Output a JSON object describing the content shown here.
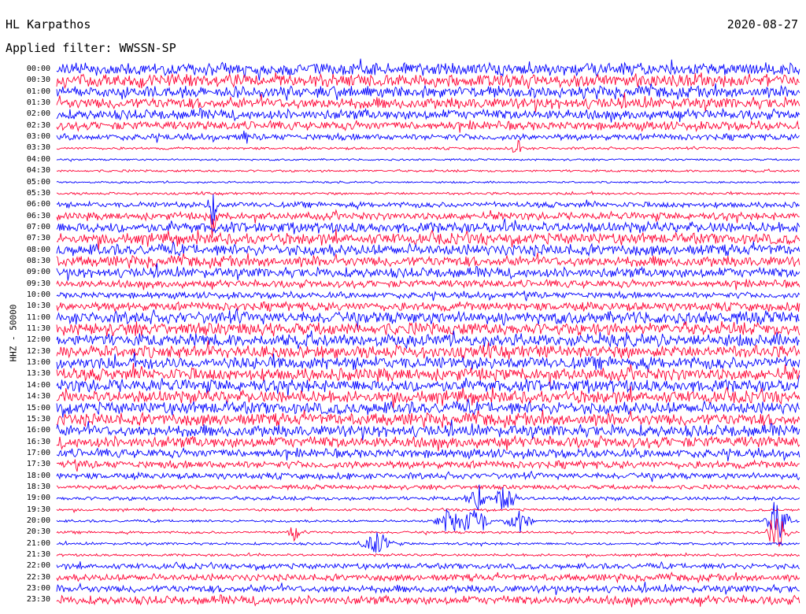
{
  "header": {
    "station": "HL Karpathos",
    "date": "2020-08-27",
    "filter": "Applied filter: WWSSN-SP"
  },
  "chart_data": {
    "type": "line",
    "title": "HL Karpathos",
    "ylabel": "HHZ - 50000",
    "row_labels": [
      "00:00",
      "00:30",
      "01:00",
      "01:30",
      "02:00",
      "02:30",
      "03:00",
      "03:30",
      "04:00",
      "04:30",
      "05:00",
      "05:30",
      "06:00",
      "06:30",
      "07:00",
      "07:30",
      "08:00",
      "08:30",
      "09:00",
      "09:30",
      "10:00",
      "10:30",
      "11:00",
      "11:30",
      "12:00",
      "12:30",
      "13:00",
      "13:30",
      "14:00",
      "14:30",
      "15:00",
      "15:30",
      "16:00",
      "16:30",
      "17:00",
      "17:30",
      "18:00",
      "18:30",
      "19:00",
      "19:30",
      "20:00",
      "20:30",
      "21:00",
      "21:30",
      "22:00",
      "22:30",
      "23:00",
      "23:30"
    ],
    "row_amplitude": [
      1.0,
      1.0,
      0.9,
      0.9,
      0.8,
      0.7,
      0.5,
      0.2,
      0.15,
      0.18,
      0.15,
      0.2,
      0.45,
      0.6,
      0.85,
      0.9,
      0.9,
      0.85,
      0.8,
      0.6,
      0.5,
      0.7,
      1.0,
      1.0,
      1.0,
      1.0,
      1.0,
      1.0,
      1.0,
      1.0,
      1.0,
      1.0,
      0.95,
      0.9,
      0.7,
      0.6,
      0.5,
      0.35,
      0.3,
      0.2,
      0.2,
      0.2,
      0.2,
      0.2,
      0.45,
      0.55,
      0.6,
      0.7
    ],
    "series_colors": [
      "#0000ff",
      "#ff0033"
    ],
    "events": [
      {
        "row": 12,
        "x_frac": 0.21,
        "amp": 6.0,
        "len": 0.008
      },
      {
        "row": 13,
        "x_frac": 0.21,
        "amp": 4.5,
        "len": 0.008
      },
      {
        "row": 6,
        "x_frac": 0.255,
        "amp": 1.8,
        "len": 0.01
      },
      {
        "row": 7,
        "x_frac": 0.62,
        "amp": 1.8,
        "len": 0.01
      },
      {
        "row": 38,
        "x_frac": 0.565,
        "amp": 2.5,
        "len": 0.02
      },
      {
        "row": 38,
        "x_frac": 0.605,
        "amp": 2.5,
        "len": 0.02
      },
      {
        "row": 40,
        "x_frac": 0.53,
        "amp": 2.2,
        "len": 0.03
      },
      {
        "row": 40,
        "x_frac": 0.56,
        "amp": 2.6,
        "len": 0.03
      },
      {
        "row": 40,
        "x_frac": 0.62,
        "amp": 2.4,
        "len": 0.025
      },
      {
        "row": 41,
        "x_frac": 0.32,
        "amp": 2.0,
        "len": 0.01
      },
      {
        "row": 42,
        "x_frac": 0.43,
        "amp": 2.0,
        "len": 0.03
      },
      {
        "row": 40,
        "x_frac": 0.97,
        "amp": 4.0,
        "len": 0.02
      },
      {
        "row": 41,
        "x_frac": 0.97,
        "amp": 3.5,
        "len": 0.02
      }
    ]
  }
}
